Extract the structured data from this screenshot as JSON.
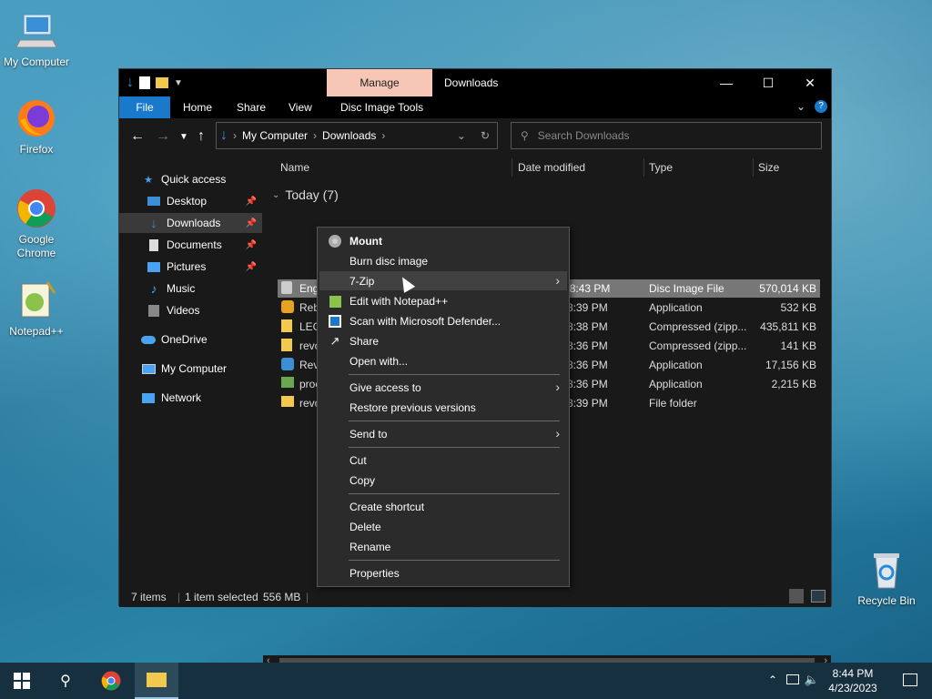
{
  "desktop": {
    "icons": [
      {
        "label": "My Computer"
      },
      {
        "label": "Firefox"
      },
      {
        "label": "Google Chrome"
      },
      {
        "label": "Notepad++"
      },
      {
        "label": "Recycle Bin"
      }
    ]
  },
  "window": {
    "manage_tab": "Manage",
    "title": "Downloads",
    "ribbon_tabs": [
      "File",
      "Home",
      "Share",
      "View",
      "Disc Image Tools"
    ],
    "breadcrumb": [
      "My Computer",
      "Downloads"
    ],
    "search_placeholder": "Search Downloads",
    "columns": [
      "Name",
      "Date modified",
      "Type",
      "Size"
    ],
    "group_label": "Today (7)",
    "files": [
      {
        "name": "English, September",
        "date": "4/23/2023 8:43 PM",
        "type": "Disc Image File",
        "size": "570,014 KB",
        "selected": true
      },
      {
        "name": "Reb",
        "date": "8:39 PM",
        "type": "Application",
        "size": "532 KB"
      },
      {
        "name": "LEG",
        "date": "8:38 PM",
        "type": "Compressed (zipp...",
        "size": "435,811 KB"
      },
      {
        "name": "revo",
        "date": "8:36 PM",
        "type": "Compressed (zipp...",
        "size": "141 KB"
      },
      {
        "name": "Rev",
        "date": "8:36 PM",
        "type": "Application",
        "size": "17,156 KB"
      },
      {
        "name": "proc",
        "date": "8:36 PM",
        "type": "Application",
        "size": "2,215 KB"
      },
      {
        "name": "revo",
        "date": "8:39 PM",
        "type": "File folder",
        "size": ""
      }
    ],
    "nav": {
      "quick_access": "Quick access",
      "desktop": "Desktop",
      "downloads": "Downloads",
      "documents": "Documents",
      "pictures": "Pictures",
      "music": "Music",
      "videos": "Videos",
      "onedrive": "OneDrive",
      "my_computer": "My Computer",
      "network": "Network"
    },
    "status": {
      "items": "7 items",
      "selected": "1 item selected",
      "size": "556 MB"
    }
  },
  "context_menu": {
    "mount": "Mount",
    "burn": "Burn disc image",
    "zip": "7-Zip",
    "notepad": "Edit with Notepad++",
    "defender": "Scan with Microsoft Defender...",
    "share": "Share",
    "open_with": "Open with...",
    "give_access": "Give access to",
    "restore": "Restore previous versions",
    "send_to": "Send to",
    "cut": "Cut",
    "copy": "Copy",
    "create_shortcut": "Create shortcut",
    "delete": "Delete",
    "rename": "Rename",
    "properties": "Properties"
  },
  "taskbar": {
    "time": "8:44 PM",
    "date": "4/23/2023"
  },
  "colors": {
    "accent": "#1979ca",
    "manage": "#f6c7b6",
    "menu_bg": "#2b2b2b"
  }
}
